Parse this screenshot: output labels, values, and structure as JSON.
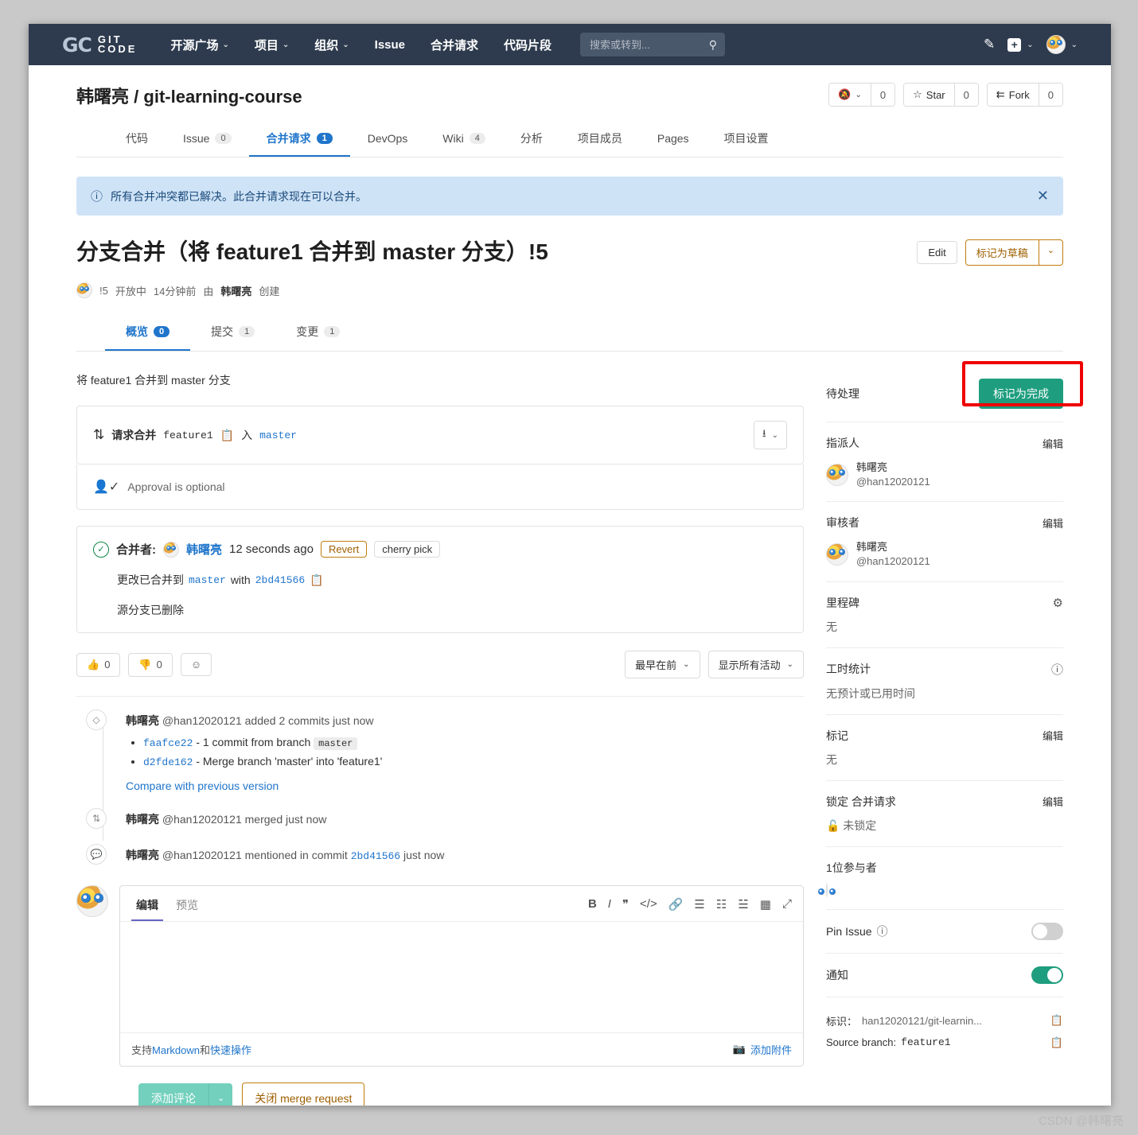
{
  "topnav": {
    "logo_mark": "GC",
    "logo_line1": "GIT",
    "logo_line2": "CODE",
    "items": [
      {
        "label": "开源广场",
        "caret": true
      },
      {
        "label": "项目",
        "caret": true
      },
      {
        "label": "组织",
        "caret": true
      },
      {
        "label": "Issue",
        "caret": false
      },
      {
        "label": "合并请求",
        "caret": false
      },
      {
        "label": "代码片段",
        "caret": false
      }
    ],
    "search_placeholder": "搜索或转到...",
    "search_value": ""
  },
  "repo": {
    "owner": "韩曙亮",
    "separator": "/",
    "name": "git-learning-course",
    "actions": [
      {
        "name": "notify",
        "label": "",
        "count": "0"
      },
      {
        "name": "star",
        "label": "Star",
        "count": "0"
      },
      {
        "name": "fork",
        "label": "Fork",
        "count": "0"
      }
    ],
    "tabs": [
      {
        "label": "代码",
        "count": null,
        "active": false
      },
      {
        "label": "Issue",
        "count": "0",
        "active": false
      },
      {
        "label": "合并请求",
        "count": "1",
        "active": true
      },
      {
        "label": "DevOps",
        "count": null,
        "active": false
      },
      {
        "label": "Wiki",
        "count": "4",
        "active": false
      },
      {
        "label": "分析",
        "count": null,
        "active": false
      },
      {
        "label": "项目成员",
        "count": null,
        "active": false
      },
      {
        "label": "Pages",
        "count": null,
        "active": false
      },
      {
        "label": "项目设置",
        "count": null,
        "active": false
      }
    ]
  },
  "alert": {
    "text": "所有合并冲突都已解决。此合并请求现在可以合并。",
    "close": "✕"
  },
  "mr": {
    "title": "分支合并（将 feature1 合并到 master 分支）!5",
    "edit_label": "Edit",
    "draft_label": "标记为草稿",
    "meta_id": "!5",
    "meta_state": "开放中",
    "meta_time": "14分钟前",
    "meta_by": "由",
    "meta_author": "韩曙亮",
    "meta_created": "创建",
    "subtabs": [
      {
        "label": "概览",
        "count": "0",
        "active": true
      },
      {
        "label": "提交",
        "count": "1",
        "active": false
      },
      {
        "label": "变更",
        "count": "1",
        "active": false
      }
    ],
    "description": "将 feature1 合并到 master 分支",
    "request_label": "请求合并",
    "source_branch": "feature1",
    "into_label": "入",
    "target_branch": "master",
    "approval_text": "Approval is optional",
    "merged_by_label": "合并者:",
    "merged_author": "韩曙亮",
    "merged_time": "12 seconds ago",
    "revert_label": "Revert",
    "cherry_pick_label": "cherry pick",
    "merged_into_prefix": "更改已合并到",
    "merged_into_branch": "master",
    "merged_with": "with",
    "merged_sha": "2bd41566",
    "source_deleted": "源分支已删除",
    "thumbs_up_count": "0",
    "thumbs_down_count": "0",
    "sort_label": "最早在前",
    "filter_label": "显示所有活动"
  },
  "timeline": [
    {
      "icon": "commit-icon",
      "author": "韩曙亮",
      "handle": "@han12020121",
      "action": "added 2 commits just now",
      "commits": [
        {
          "sha": "faafce22",
          "text": "- 1 commit from branch",
          "chip": "master"
        },
        {
          "sha": "d2fde162",
          "text": "- Merge branch 'master' into 'feature1'",
          "chip": null
        }
      ],
      "link": "Compare with previous version"
    },
    {
      "icon": "merge-icon",
      "author": "韩曙亮",
      "handle": "@han12020121",
      "action": "merged just now",
      "commits": [],
      "link": null
    },
    {
      "icon": "comment-icon",
      "author": "韩曙亮",
      "handle": "@han12020121",
      "action": "mentioned in commit",
      "sha": "2bd41566",
      "action_suffix": "just now",
      "commits": [],
      "link": null
    }
  ],
  "editor": {
    "tab_edit": "编辑",
    "tab_preview": "预览",
    "tools": [
      "B",
      "I",
      "❞",
      "</>",
      "🔗",
      "☰",
      "☷",
      "☱",
      "▦",
      "⤢"
    ],
    "body_value": "",
    "markdown_hint_prefix": "支持",
    "markdown_hint_link1": "Markdown",
    "markdown_hint_mid": "和",
    "markdown_hint_link2": "快速操作",
    "attach_label": "添加附件",
    "submit_label": "添加评论",
    "close_label": "关闭 merge request"
  },
  "sidebar": {
    "pending_label": "待处理",
    "mark_done_label": "标记为完成",
    "assignee_title": "指派人",
    "assignee_edit": "编辑",
    "assignee_name": "韩曙亮",
    "assignee_handle": "@han12020121",
    "reviewer_title": "审核者",
    "reviewer_edit": "编辑",
    "reviewer_name": "韩曙亮",
    "reviewer_handle": "@han12020121",
    "milestone_title": "里程碑",
    "milestone_value": "无",
    "time_title": "工时统计",
    "time_value": "无预计或已用时间",
    "labels_title": "标记",
    "labels_edit": "编辑",
    "labels_value": "无",
    "lock_title": "锁定 合并请求",
    "lock_edit": "编辑",
    "lock_value": "未锁定",
    "participants_title": "1位参与者",
    "pin_label": "Pin Issue",
    "pin_on": false,
    "notify_label": "通知",
    "notify_on": true,
    "identifier_label": "标识：",
    "identifier_value": "han12020121/git-learnin...",
    "source_branch_label": "Source branch:",
    "source_branch_value": "feature1"
  },
  "watermark": "CSDN @韩曙亮",
  "colors": {
    "nav_bg": "#2e3b4e",
    "accent_blue": "#1f75cb",
    "green": "#1e9e7e",
    "orange": "#c17d10",
    "alert_bg": "#cfe3f7",
    "highlight_red": "#ef0000"
  }
}
